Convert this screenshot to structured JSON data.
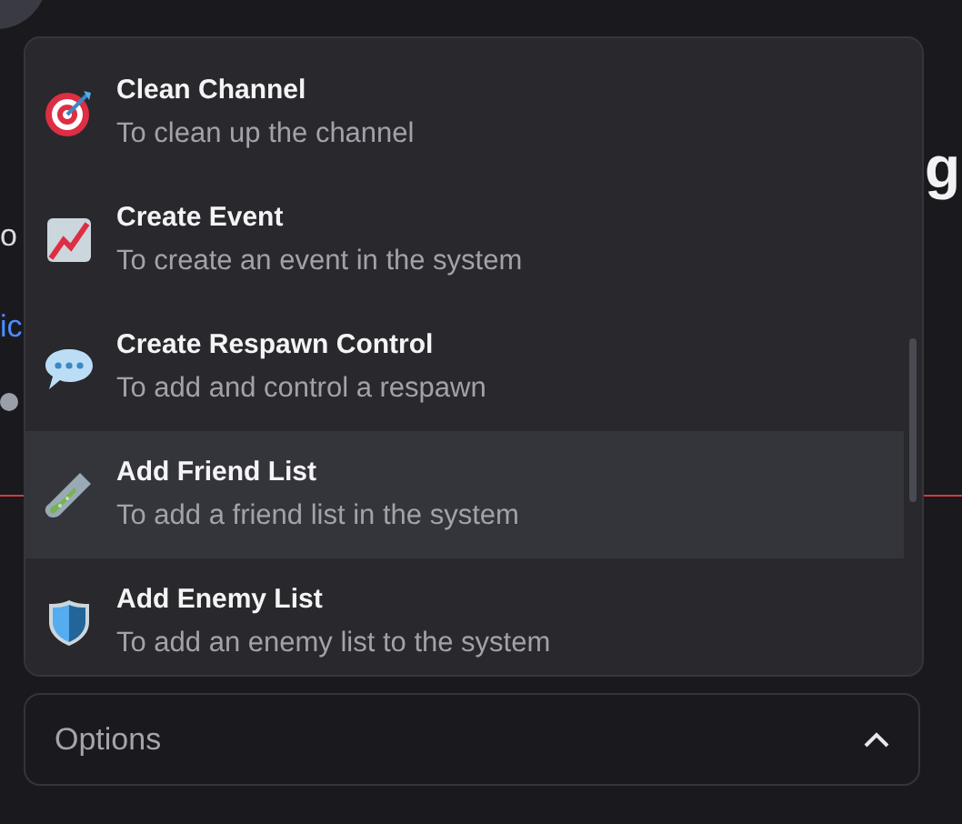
{
  "background": {
    "heading_right": "g",
    "line_fragment": "o",
    "link_fragment": "ic"
  },
  "menu": {
    "items": [
      {
        "title": "Clean Channel",
        "description": "To clean up the channel",
        "selected": false
      },
      {
        "title": "Create Event",
        "description": "To create an event in the system",
        "selected": false
      },
      {
        "title": "Create Respawn Control",
        "description": "To add and control a respawn",
        "selected": false
      },
      {
        "title": "Add Friend List",
        "description": "To add a friend list in the system",
        "selected": true
      },
      {
        "title": "Add Enemy List",
        "description": "To add an enemy list to the system",
        "selected": false
      }
    ]
  },
  "select": {
    "placeholder": "Options",
    "expanded": true
  }
}
